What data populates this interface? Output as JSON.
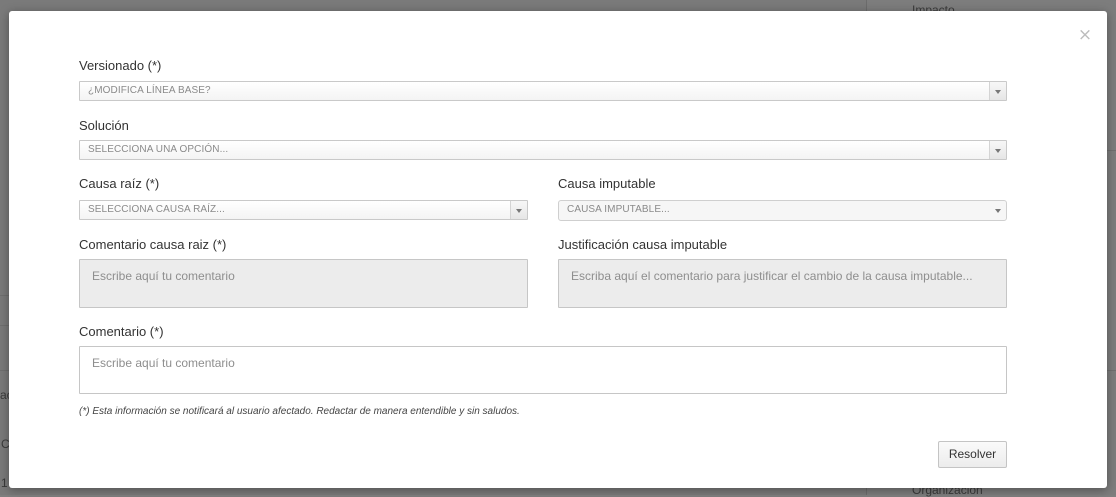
{
  "background": {
    "right_top_text": "Impacto",
    "right_bottom_text": "Organización",
    "left_text_1": "ac",
    "left_text_2": "C",
    "left_text_3": "1"
  },
  "modal": {
    "close_glyph": "×",
    "versionado": {
      "label": "Versionado (*)",
      "placeholder": "¿MODIFICA LÍNEA BASE?"
    },
    "solucion": {
      "label": "Solución",
      "placeholder": "SELECCIONA UNA OPCIÓN..."
    },
    "causa_raiz": {
      "label": "Causa raíz (*)",
      "placeholder": "SELECCIONA CAUSA RAÍZ..."
    },
    "causa_imputable": {
      "label": "Causa imputable",
      "placeholder": "CAUSA IMPUTABLE..."
    },
    "comentario_causa_raiz": {
      "label": "Comentario causa raiz (*)",
      "placeholder": "Escribe aquí tu comentario"
    },
    "justificacion": {
      "label": "Justificación causa imputable",
      "placeholder": "Escriba aquí el comentario para justificar el cambio de la causa imputable..."
    },
    "comentario": {
      "label": "Comentario (*)",
      "placeholder": "Escribe aquí tu comentario"
    },
    "note": "(*) Esta información se notificará al usuario afectado. Redactar de manera entendible y sin saludos.",
    "resolve_label": "Resolver"
  }
}
